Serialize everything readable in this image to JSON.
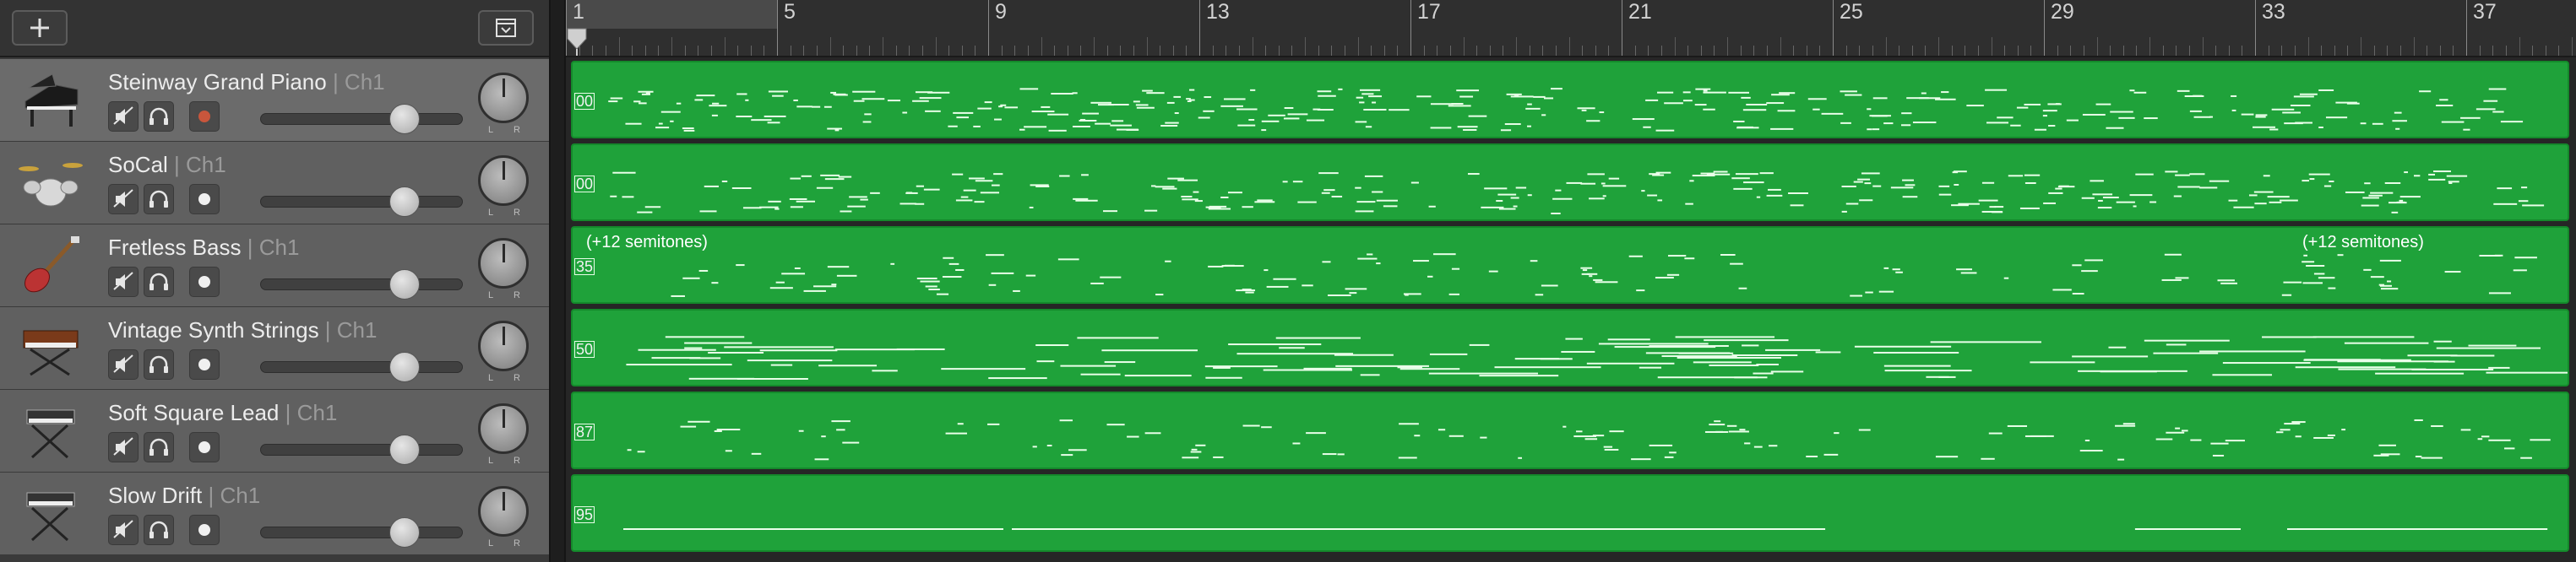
{
  "toolbar": {
    "add_icon": "plus-icon",
    "collapse_icon": "chevron-down-box-icon"
  },
  "ruler": {
    "playhead_icon": "playhead-marker-icon",
    "bars": [
      {
        "label": "1",
        "bar": 1
      },
      {
        "label": "5",
        "bar": 5
      },
      {
        "label": "9",
        "bar": 9
      },
      {
        "label": "13",
        "bar": 13
      },
      {
        "label": "17",
        "bar": 17
      },
      {
        "label": "21",
        "bar": 21
      },
      {
        "label": "25",
        "bar": 25
      },
      {
        "label": "29",
        "bar": 29
      },
      {
        "label": "33",
        "bar": 33
      },
      {
        "label": "37",
        "bar": 37
      }
    ]
  },
  "tracks": [
    {
      "name": "Steinway Grand Piano",
      "channel": "| Ch1",
      "icon": "grand-piano-icon",
      "record_armed": true,
      "region_label": "00",
      "region_note": ""
    },
    {
      "name": "SoCal",
      "channel": "| Ch1",
      "icon": "drum-kit-icon",
      "record_armed": false,
      "region_label": "00",
      "region_note": ""
    },
    {
      "name": "Fretless Bass",
      "channel": "| Ch1",
      "icon": "bass-guitar-icon",
      "record_armed": false,
      "region_label": "35",
      "region_note": "(+12 semitones)",
      "region_note_right": "(+12 semitones)"
    },
    {
      "name": "Vintage Synth Strings",
      "channel": "| Ch1",
      "icon": "synthesizer-icon",
      "record_armed": false,
      "region_label": "50",
      "region_note": ""
    },
    {
      "name": "Soft Square Lead",
      "channel": "| Ch1",
      "icon": "keyboard-stand-icon",
      "record_armed": false,
      "region_label": "87",
      "region_note": ""
    },
    {
      "name": "Slow Drift",
      "channel": "| Ch1",
      "icon": "keyboard-stand-icon",
      "record_armed": false,
      "region_label": "95",
      "region_note": ""
    }
  ],
  "buttons": {
    "mute_icon": "mute-speaker-icon",
    "solo_icon": "headphones-icon",
    "record_icon": "record-icon"
  },
  "pan_labels": {
    "left": "L",
    "right": "R"
  },
  "colors": {
    "region": "#1fa23a",
    "region_border": "#148a2b",
    "record_active": "#c9563c"
  }
}
